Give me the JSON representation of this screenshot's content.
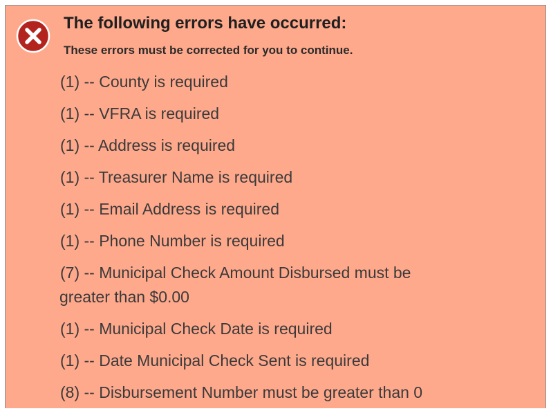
{
  "heading": "The following errors have occurred:",
  "subheading": "These errors must be corrected for you to continue.",
  "icon": "error-circle-x-icon",
  "colors": {
    "panel_background": "#ffa98c",
    "icon_fill": "#b3241e"
  },
  "errors": [
    {
      "text": "(1) -- County is required"
    },
    {
      "text": "(1) -- VFRA is required"
    },
    {
      "text": "(1) -- Address is required"
    },
    {
      "text": "(1) -- Treasurer Name is required"
    },
    {
      "text": "(1) -- Email Address is required"
    },
    {
      "text": "(1) -- Phone Number is required"
    },
    {
      "text": "(7) -- Municipal Check Amount Disbursed must be",
      "text2": "greater than $0.00"
    },
    {
      "text": "(1) -- Municipal Check Date is required"
    },
    {
      "text": "(1) -- Date Municipal Check Sent is required"
    },
    {
      "text": "(8) -- Disbursement Number must be greater than 0"
    }
  ]
}
